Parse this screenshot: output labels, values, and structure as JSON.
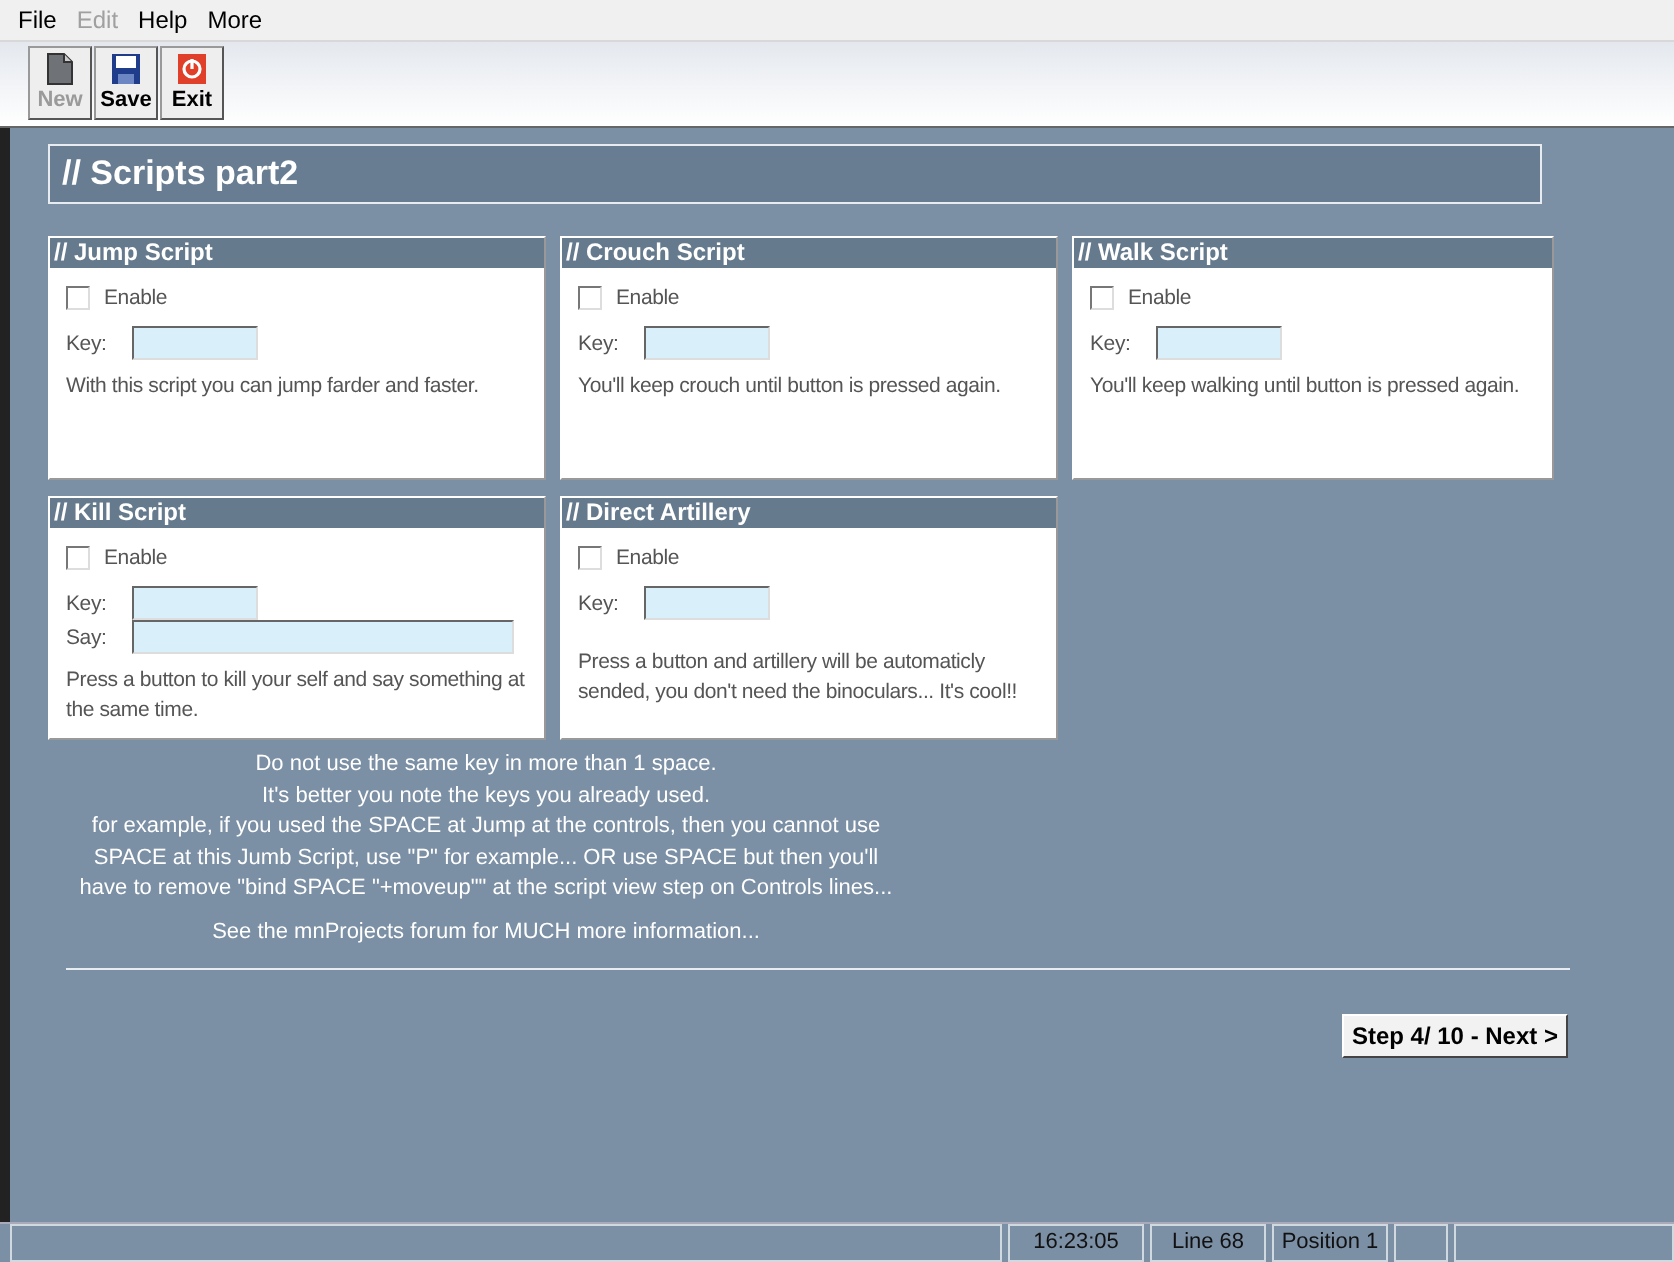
{
  "menu": [
    {
      "label": "File",
      "disabled": false
    },
    {
      "label": "Edit",
      "disabled": true
    },
    {
      "label": "Help",
      "disabled": false
    },
    {
      "label": "More",
      "disabled": false
    }
  ],
  "toolbar": [
    {
      "label": "New",
      "kind": "new",
      "disabled": true
    },
    {
      "label": "Save",
      "kind": "save",
      "disabled": false
    },
    {
      "label": "Exit",
      "kind": "exit",
      "disabled": false
    }
  ],
  "page_title": "// Scripts part2",
  "panels": [
    {
      "title": "// Jump Script",
      "enable": {
        "label": "Enable",
        "checked": false
      },
      "fields": [
        {
          "label": "Key:",
          "kind": "short"
        }
      ],
      "description": "With this script you can jump farder and faster."
    },
    {
      "title": "// Crouch Script",
      "enable": {
        "label": "Enable",
        "checked": false
      },
      "fields": [
        {
          "label": "Key:",
          "kind": "short"
        }
      ],
      "description": "You'll keep crouch until button is pressed again."
    },
    {
      "title": "// Walk Script",
      "enable": {
        "label": "Enable",
        "checked": false
      },
      "fields": [
        {
          "label": "Key:",
          "kind": "short"
        }
      ],
      "description": "You'll keep walking until button is pressed again."
    },
    {
      "title": "// Kill Script",
      "enable": {
        "label": "Enable",
        "checked": false
      },
      "fields": [
        {
          "label": "Key:",
          "kind": "short"
        },
        {
          "label": "Say:",
          "kind": "long"
        }
      ],
      "description": "Press a button to kill your self and say something at the same time."
    },
    {
      "title": "// Direct Artillery",
      "enable": {
        "label": "Enable",
        "checked": false
      },
      "fields": [
        {
          "label": "Key:",
          "kind": "short"
        }
      ],
      "description": "Press a button and artillery will be automaticly sended, you don't need the binoculars... It's cool!!"
    }
  ],
  "notes": [
    "Do not use the same key in more than 1 space.",
    "It's better you note the keys you already used.",
    "for example, if you used the SPACE at Jump at the controls, then you cannot use",
    "SPACE at this Jumb Script, use \"P\" for example... OR use SPACE but then you'll",
    "have to remove \"bind SPACE \"+moveup\"\" at the script view step on Controls lines..."
  ],
  "forum_note": "See the mnProjects forum for MUCH more information...",
  "next_button": "Step 4/ 10 - Next >",
  "status_bar": [
    "16:23:05",
    "Line 68",
    "Position 1"
  ]
}
